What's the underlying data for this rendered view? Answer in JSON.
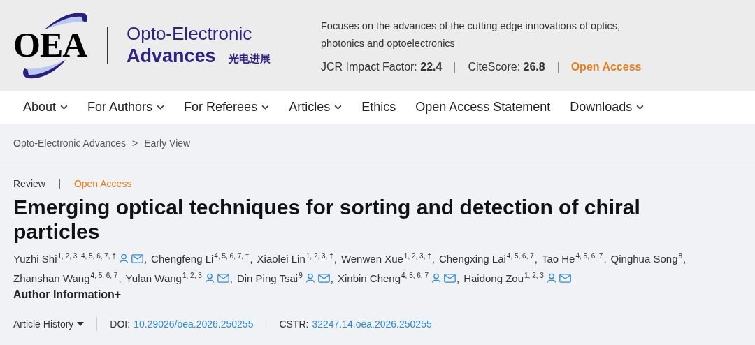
{
  "header": {
    "logo": "OEA",
    "journal_line1": "Opto-Electronic",
    "journal_line2": "Advances",
    "journal_cn": "光电进展",
    "tagline": "Focuses on the advances of the cutting edge innovations of optics, photonics and optoelectronics",
    "metrics": [
      {
        "label": "JCR Impact Factor:",
        "value": "22.4"
      },
      {
        "label": "CiteScore:",
        "value": "26.8"
      }
    ],
    "open_access": "Open Access"
  },
  "nav": [
    {
      "label": "About",
      "dropdown": true
    },
    {
      "label": "For Authors",
      "dropdown": true
    },
    {
      "label": "For Referees",
      "dropdown": true
    },
    {
      "label": "Articles",
      "dropdown": true
    },
    {
      "label": "Ethics",
      "dropdown": false
    },
    {
      "label": "Open Access Statement",
      "dropdown": false
    },
    {
      "label": "Downloads",
      "dropdown": true
    }
  ],
  "breadcrumb": [
    "Opto-Electronic Advances",
    "Early View"
  ],
  "breadcrumb_sep": ">",
  "article": {
    "type": "Review",
    "access": "Open Access",
    "title": "Emerging optical techniques for sorting and detection of chiral particles",
    "authors": [
      {
        "name": "Yuzhi Shi",
        "affiliations": "1, 2, 3, 4, 5, 6, 7, †",
        "contact": true,
        "sep": ","
      },
      {
        "name": "Chengfeng Li",
        "affiliations": "4, 5, 6, 7, †",
        "contact": false,
        "sep": ","
      },
      {
        "name": "Xiaolei Lin",
        "affiliations": "1, 2, 3, †",
        "contact": false,
        "sep": ","
      },
      {
        "name": "Wenwen Xue",
        "affiliations": "1, 2, 3, †",
        "contact": false,
        "sep": ","
      },
      {
        "name": "Chengxing Lai",
        "affiliations": "4, 5, 6, 7",
        "contact": false,
        "sep": ","
      },
      {
        "name": "Tao He",
        "affiliations": "4, 5, 6, 7",
        "contact": false,
        "sep": ","
      },
      {
        "name": "Qinghua Song",
        "affiliations": "8",
        "contact": false,
        "sep": ","
      },
      {
        "name": "Zhanshan Wang",
        "affiliations": "4, 5, 6, 7",
        "contact": false,
        "sep": ","
      },
      {
        "name": "Yulan Wang",
        "affiliations": "1, 2, 3",
        "contact": true,
        "sep": ","
      },
      {
        "name": "Din Ping Tsai",
        "affiliations": "9",
        "contact": true,
        "sep": ","
      },
      {
        "name": "Xinbin Cheng",
        "affiliations": "4, 5, 6, 7",
        "contact": true,
        "sep": ","
      },
      {
        "name": "Haidong Zou",
        "affiliations": "1, 2, 3",
        "contact": true
      }
    ],
    "author_info": "Author Information+",
    "history": "Article History",
    "doi_label": "DOI:",
    "doi": "10.29026/oea.2026.250255",
    "cstr_label": "CSTR:",
    "cstr": "32247.14.oea.2026.250255"
  }
}
